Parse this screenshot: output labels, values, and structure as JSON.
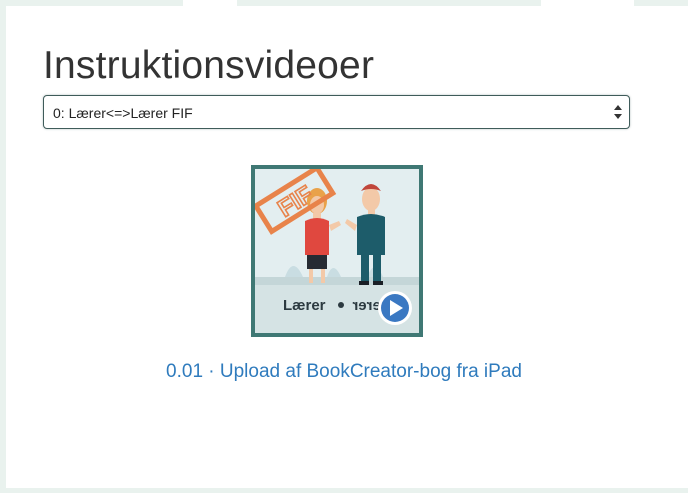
{
  "page": {
    "title": "Instruktionsvideoer"
  },
  "category_select": {
    "value": "0: Lærer<=>Lærer FIF"
  },
  "videos": [
    {
      "link_text": "0.01 · Upload af BookCreator-bog fra iPad",
      "thumbnail_stamp": "FIF",
      "thumbnail_caption": "Lærer",
      "thumbnail_caption_mirrored": "Lærer"
    }
  ],
  "colors": {
    "accent_teal": "#3f7874",
    "link_blue": "#2f7bbd",
    "play_blue": "#3a78c2",
    "stamp_orange": "#e8834a"
  }
}
